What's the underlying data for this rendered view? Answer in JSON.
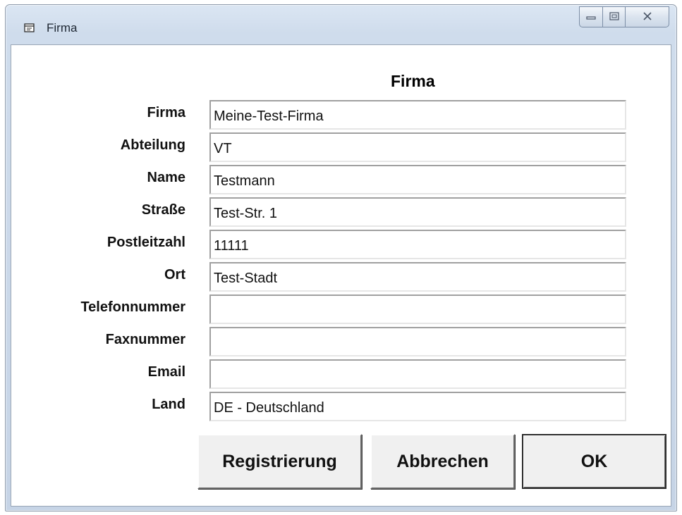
{
  "window": {
    "title": "Firma",
    "icon": "form-window-icon",
    "caption_buttons": {
      "minimize": "minimize-icon",
      "maximize": "maximize-icon",
      "close": "close-icon"
    }
  },
  "form": {
    "heading": "Firma",
    "fields": [
      {
        "label": "Firma",
        "value": "Meine-Test-Firma"
      },
      {
        "label": "Abteilung",
        "value": "VT"
      },
      {
        "label": "Name",
        "value": "Testmann"
      },
      {
        "label": "Straße",
        "value": "Test-Str. 1"
      },
      {
        "label": "Postleitzahl",
        "value": "11111"
      },
      {
        "label": "Ort",
        "value": "Test-Stadt"
      },
      {
        "label": "Telefonnummer",
        "value": ""
      },
      {
        "label": "Faxnummer",
        "value": ""
      },
      {
        "label": "Email",
        "value": ""
      },
      {
        "label": "Land",
        "value": "DE - Deutschland"
      }
    ]
  },
  "buttons": {
    "register": "Registrierung",
    "cancel": "Abbrechen",
    "ok": "OK"
  },
  "colors": {
    "frame": "#cfdcec",
    "client_background": "#ffffff",
    "button_face": "#f0f0f0"
  }
}
